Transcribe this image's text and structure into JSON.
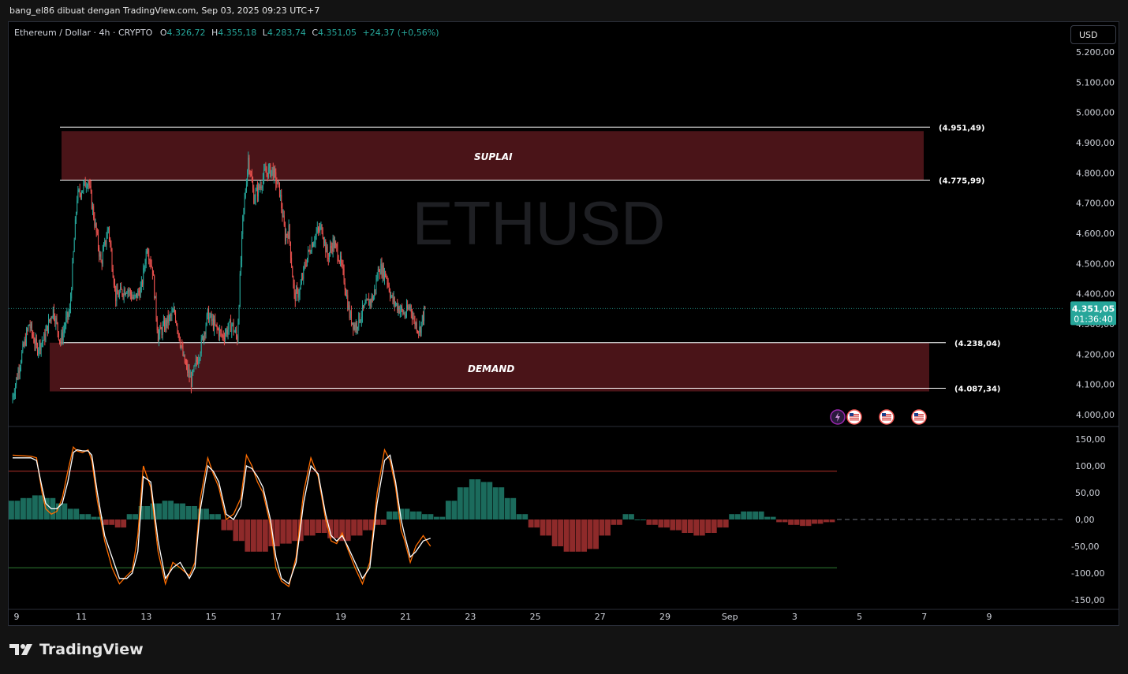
{
  "header": {
    "attribution": "bang_el86 dibuat dengan TradingView.com, Sep 03, 2025 09:23 UTC+7"
  },
  "legend": {
    "symbol": "Ethereum / Dollar · 4h · CRYPTO",
    "o_label": "O",
    "o_value": "4.326,72",
    "h_label": "H",
    "h_value": "4.355,18",
    "l_label": "L",
    "l_value": "4.283,74",
    "c_label": "C",
    "c_value": "4.351,05",
    "change": "+24,37 (+0,56%)"
  },
  "currency_button": "USD",
  "watermark": "ETHUSD",
  "footer": {
    "brand": "TradingView"
  },
  "colors": {
    "up": "#26a69a",
    "down": "#ef5350",
    "zone_fill": "#4a1418",
    "price_tag": "#26a69a",
    "osc_white": "#ffffff",
    "osc_orange": "#ff6d00",
    "hist_up": "#1b6b5c",
    "hist_down": "#8e2a2a",
    "upper_band": "#b2312b",
    "lower_band": "#2e7d32"
  },
  "icons": [
    "lightning-event-icon",
    "us-flag-event-icon",
    "us-flag-event-icon",
    "us-flag-event-icon"
  ],
  "chart_data": {
    "type": "candlestick",
    "title": "Ethereum / Dollar · 4h · CRYPTO",
    "y_ticks": [
      "5.200,00",
      "5.100,00",
      "5.000,00",
      "4.900,00",
      "4.800,00",
      "4.700,00",
      "4.600,00",
      "4.500,00",
      "4.400,00",
      "4.300,00",
      "4.200,00",
      "4.100,00",
      "4.000,00"
    ],
    "ylim": [
      3960,
      5235
    ],
    "x_ticks": [
      "9",
      "11",
      "13",
      "15",
      "17",
      "19",
      "21",
      "23",
      "25",
      "27",
      "29",
      "Sep",
      "3",
      "5",
      "7",
      "9"
    ],
    "current_price": {
      "price": "4.351,05",
      "countdown": "01:36:40",
      "value": 4351.05
    },
    "zones": [
      {
        "name": "SUPLAI",
        "top": 4951.49,
        "bottom": 4775.99,
        "top_label": "(4.951,49)",
        "bottom_label": "(4.775,99)"
      },
      {
        "name": "DEMAND",
        "top": 4238.04,
        "bottom": 4087.34,
        "top_label": "(4.238,04)",
        "bottom_label": "(4.087,34)"
      }
    ],
    "close_path": [
      [
        0,
        4060
      ],
      [
        10,
        4200
      ],
      [
        18,
        4300
      ],
      [
        26,
        4220
      ],
      [
        34,
        4250
      ],
      [
        44,
        4350
      ],
      [
        52,
        4240
      ],
      [
        58,
        4310
      ],
      [
        62,
        4340
      ],
      [
        70,
        4720
      ],
      [
        82,
        4780
      ],
      [
        88,
        4660
      ],
      [
        96,
        4500
      ],
      [
        104,
        4620
      ],
      [
        112,
        4390
      ],
      [
        124,
        4420
      ],
      [
        132,
        4380
      ],
      [
        140,
        4420
      ],
      [
        146,
        4560
      ],
      [
        152,
        4480
      ],
      [
        158,
        4260
      ],
      [
        166,
        4300
      ],
      [
        176,
        4340
      ],
      [
        186,
        4180
      ],
      [
        194,
        4110
      ],
      [
        204,
        4220
      ],
      [
        212,
        4330
      ],
      [
        220,
        4290
      ],
      [
        228,
        4260
      ],
      [
        238,
        4300
      ],
      [
        244,
        4250
      ],
      [
        250,
        4640
      ],
      [
        256,
        4850
      ],
      [
        262,
        4720
      ],
      [
        268,
        4750
      ],
      [
        274,
        4800
      ],
      [
        282,
        4810
      ],
      [
        290,
        4740
      ],
      [
        296,
        4590
      ],
      [
        300,
        4610
      ],
      [
        306,
        4390
      ],
      [
        312,
        4410
      ],
      [
        318,
        4500
      ],
      [
        324,
        4560
      ],
      [
        330,
        4600
      ],
      [
        336,
        4620
      ],
      [
        342,
        4520
      ],
      [
        348,
        4570
      ],
      [
        354,
        4530
      ],
      [
        360,
        4450
      ],
      [
        366,
        4330
      ],
      [
        372,
        4290
      ],
      [
        380,
        4340
      ],
      [
        386,
        4370
      ],
      [
        392,
        4390
      ],
      [
        398,
        4490
      ],
      [
        406,
        4460
      ],
      [
        412,
        4380
      ],
      [
        418,
        4360
      ],
      [
        426,
        4330
      ],
      [
        432,
        4360
      ],
      [
        436,
        4310
      ],
      [
        442,
        4280
      ],
      [
        448,
        4350
      ]
    ],
    "oscillator": {
      "y_ticks": [
        "150,00",
        "100,00",
        "50,00",
        "0,00",
        "-50,00",
        "-100,00",
        "-150,00"
      ],
      "ylim": [
        -160,
        160
      ],
      "upper_band": 90,
      "lower_band": -90,
      "wave_x": [
        0,
        20,
        26,
        32,
        36,
        42,
        48,
        54,
        60,
        66,
        70,
        76,
        82,
        86,
        92,
        100,
        108,
        116,
        124,
        130,
        136,
        142,
        150,
        158,
        166,
        174,
        182,
        192,
        198,
        204,
        212,
        218,
        224,
        232,
        240,
        248,
        254,
        260,
        266,
        272,
        280,
        286,
        292,
        300,
        308,
        316,
        324,
        332,
        340,
        346,
        352,
        358,
        364,
        372,
        380,
        388,
        396,
        404,
        410,
        416,
        422,
        426,
        432,
        438,
        446,
        454
      ],
      "osc_white": [
        115,
        115,
        110,
        60,
        30,
        20,
        20,
        30,
        70,
        125,
        130,
        128,
        128,
        120,
        50,
        -30,
        -70,
        -110,
        -110,
        -100,
        -60,
        80,
        70,
        -40,
        -110,
        -90,
        -80,
        -110,
        -90,
        20,
        100,
        90,
        70,
        10,
        0,
        25,
        100,
        95,
        80,
        60,
        0,
        -70,
        -110,
        -120,
        -80,
        30,
        100,
        85,
        10,
        -30,
        -40,
        -30,
        -50,
        -80,
        -110,
        -90,
        30,
        110,
        120,
        70,
        0,
        -30,
        -70,
        -60,
        -40,
        -35
      ],
      "osc_orange": [
        120,
        118,
        115,
        50,
        20,
        10,
        15,
        40,
        90,
        135,
        128,
        125,
        130,
        110,
        35,
        -40,
        -90,
        -120,
        -105,
        -95,
        -30,
        100,
        60,
        -60,
        -120,
        -80,
        -90,
        -105,
        -80,
        40,
        115,
        85,
        60,
        0,
        10,
        40,
        120,
        100,
        70,
        50,
        -10,
        -90,
        -115,
        -125,
        -70,
        50,
        115,
        80,
        0,
        -40,
        -45,
        -25,
        -55,
        -90,
        -120,
        -80,
        50,
        130,
        110,
        60,
        -20,
        -40,
        -80,
        -50,
        -30,
        -50
      ],
      "histogram": [
        35,
        40,
        45,
        40,
        30,
        20,
        10,
        5,
        -10,
        -15,
        10,
        25,
        30,
        35,
        30,
        25,
        20,
        10,
        -20,
        -40,
        -60,
        -60,
        -50,
        -45,
        -40,
        -30,
        -25,
        -35,
        -40,
        -30,
        -20,
        -10,
        15,
        20,
        15,
        10,
        5,
        35,
        60,
        75,
        70,
        60,
        40,
        10,
        -15,
        -30,
        -50,
        -60,
        -60,
        -55,
        -30,
        -10,
        10,
        0,
        -10,
        -15,
        -20,
        -25,
        -30,
        -25,
        -15,
        10,
        15,
        15,
        5,
        -5,
        -10,
        -12,
        -8,
        -5
      ]
    }
  }
}
